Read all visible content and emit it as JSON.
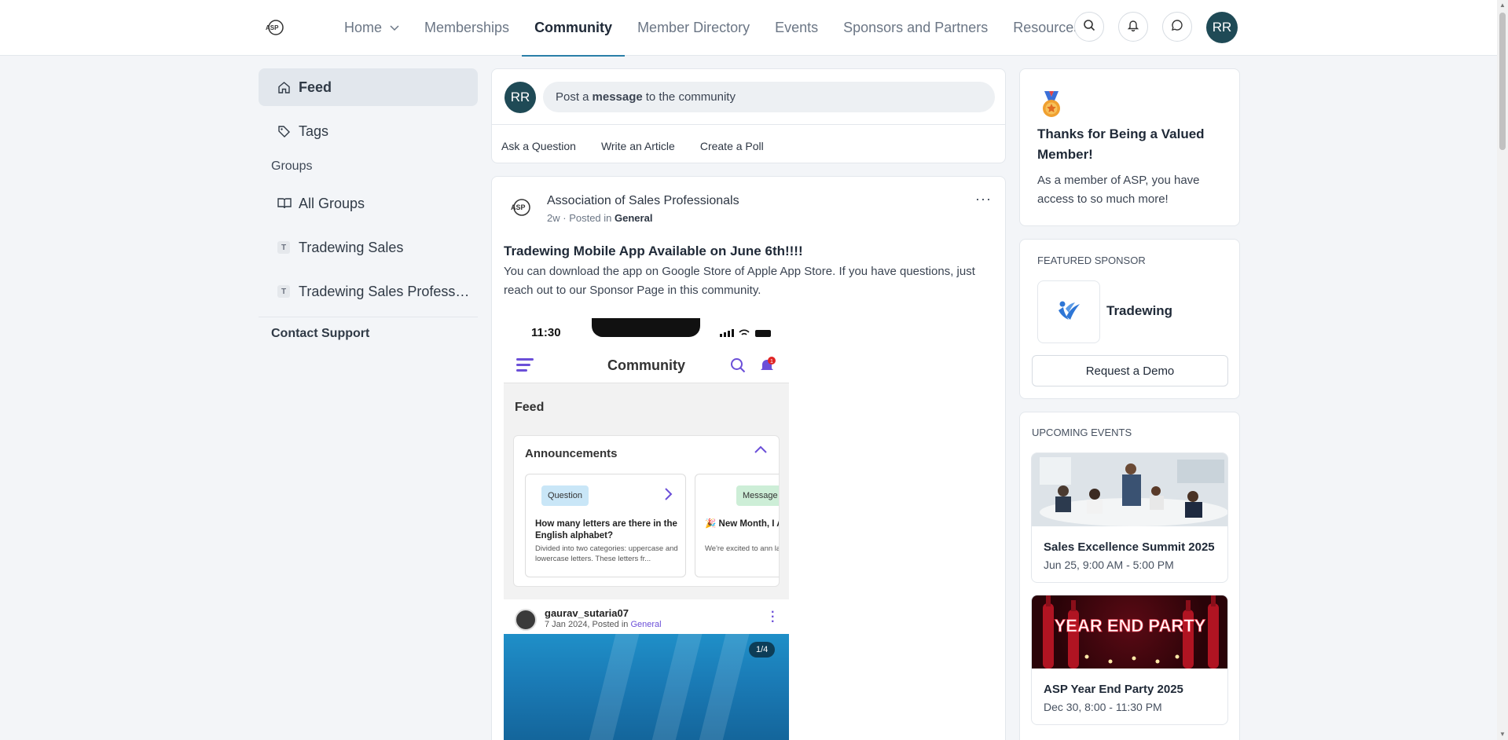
{
  "header": {
    "nav": [
      {
        "label": "Home",
        "dropdown": true
      },
      {
        "label": "Memberships"
      },
      {
        "label": "Community",
        "active": true
      },
      {
        "label": "Member Directory"
      },
      {
        "label": "Events"
      },
      {
        "label": "Sponsors and Partners"
      },
      {
        "label": "Resources"
      }
    ],
    "icons": [
      "search-icon",
      "bell-icon",
      "chat-icon"
    ],
    "avatar_initials": "RR",
    "accent_color": "#2a7fa8"
  },
  "sidebar": {
    "items": [
      {
        "label": "Feed",
        "icon": "home-icon",
        "active": true
      },
      {
        "label": "Tags",
        "icon": "tag-icon"
      }
    ],
    "groups_heading": "Groups",
    "groups": [
      {
        "label": "All Groups",
        "icon": "book-icon"
      },
      {
        "label": "Tradewing Sales",
        "badge": "T"
      },
      {
        "label": "Tradewing Sales Profess…",
        "badge": "T"
      }
    ],
    "contact_support": "Contact Support"
  },
  "composer": {
    "avatar_initials": "RR",
    "prompt_before": "Post a",
    "prompt_bold": "message",
    "prompt_after": "to the community",
    "actions": [
      "Ask a Question",
      "Write an Article",
      "Create a Poll"
    ]
  },
  "post": {
    "author": "Association of Sales Professionals",
    "time": "2w",
    "posted_in_label": "Posted in",
    "category": "General",
    "title": "Tradewing Mobile App Available on June 6th!!!!",
    "body": "You can download the app on Google Store of Apple App Store. If you have questions, just reach out to our Sponsor Page in this community.",
    "image": {
      "time": "11:30",
      "header_title": "Community",
      "notification_count": "1",
      "feed_label": "Feed",
      "announcements_label": "Announcements",
      "cards": [
        {
          "tag": "Question",
          "title": "How many letters are there in the English alphabet?",
          "text": "Divided into two categories: uppercase and lowercase letters. These letters fr..."
        },
        {
          "tag": "Message",
          "title": "🎉 New Month, I Alert! 🔔",
          "text": "We're excited to ann latest post for this m"
        }
      ],
      "user": "gaurav_sutaria07",
      "user_meta": "7 Jan 2024, Posted in",
      "user_category": "General",
      "counter": "1/4"
    }
  },
  "thanks_card": {
    "title": "Thanks for Being a Valued Member!",
    "body": "As a member of ASP, you have access to so much more!"
  },
  "featured_sponsor": {
    "label": "FEATURED SPONSOR",
    "name": "Tradewing",
    "button": "Request a Demo"
  },
  "upcoming_events": {
    "label": "UPCOMING EVENTS",
    "events": [
      {
        "title": "Sales Excellence Summit 2025",
        "date": "Jun 25, 9:00 AM - 5:00 PM"
      },
      {
        "title": "ASP Year End Party 2025",
        "date": "Dec 30, 8:00 - 11:30 PM",
        "image_text": "YEAR END PARTY"
      }
    ]
  }
}
